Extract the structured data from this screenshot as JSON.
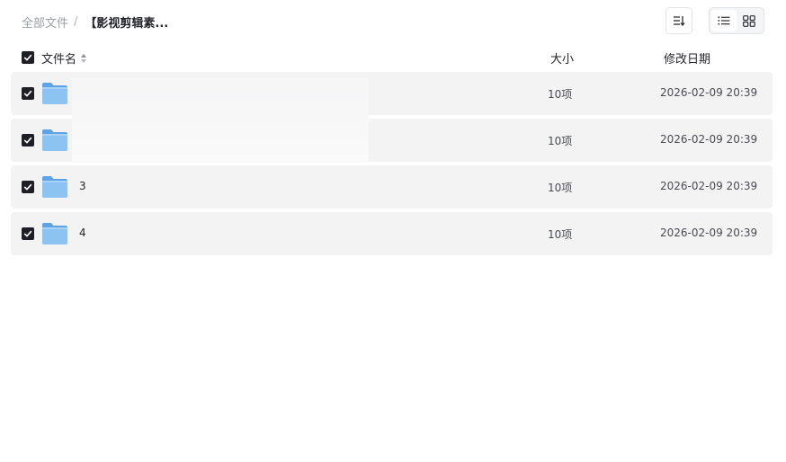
{
  "breadcrumb": {
    "root": "全部文件",
    "separator": "/",
    "current": "【影视剪辑素..."
  },
  "toolbar": {
    "sort_icon": "sort-icon",
    "list_view_icon": "list-view-icon",
    "grid_view_icon": "grid-view-icon"
  },
  "table": {
    "headers": {
      "name": "文件名",
      "size": "大小",
      "date": "修改日期"
    },
    "rows": [
      {
        "name": "",
        "size": "10项",
        "date": "2026-02-09 20:39"
      },
      {
        "name": "",
        "size": "10项",
        "date": "2026-02-09 20:39"
      },
      {
        "name": "3",
        "size": "10项",
        "date": "2026-02-09 20:39"
      },
      {
        "name": "4",
        "size": "10项",
        "date": "2026-02-09 20:39"
      }
    ]
  },
  "colors": {
    "checkbox": "#1e1f24",
    "row_background": "#f3f3f4",
    "folder_blue": "#7fb8f0"
  }
}
